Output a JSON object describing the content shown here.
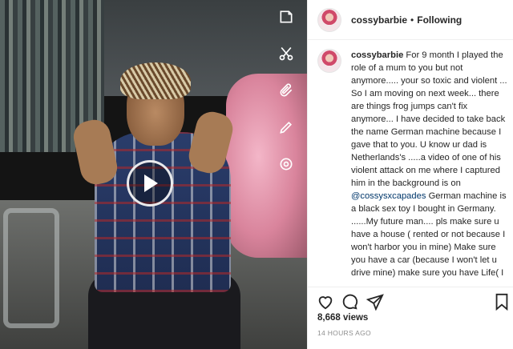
{
  "video": {
    "tools": [
      "sticker-icon",
      "scissors-icon",
      "paperclip-icon",
      "pencil-icon",
      "shape-icon"
    ],
    "play_icon": "play-icon"
  },
  "post": {
    "username": "cossybarbie",
    "separator": "•",
    "follow_state": "Following",
    "caption": {
      "username": "cossybarbie",
      "text_before_mention": "For 9 month I played the role of a mum to you but not anymore..... your so toxic and violent ... So I am moving on next week... there are things frog jumps can't fix anymore... I have decided to take back the name German machine because I gave that to you. U know ur dad is Netherlands's .....a video of one of his violent attack on me where I captured him in the background is on",
      "mention": "@cossysxcapades",
      "text_after_mention": "German machine is a black sex toy I bought in Germany. ......My future man.... pls make sure u have a house ( rented or not because I won't harbor you in mine) Make sure you have a car (because I won't let u drive mine) make sure you have Life( I don't need a body guard to police me around my male friends) make sure u"
    },
    "actions": [
      "heart-icon",
      "comment-icon",
      "share-icon",
      "bookmark-icon"
    ],
    "views": "8,668 views",
    "timestamp": "14 HOURS AGO"
  }
}
